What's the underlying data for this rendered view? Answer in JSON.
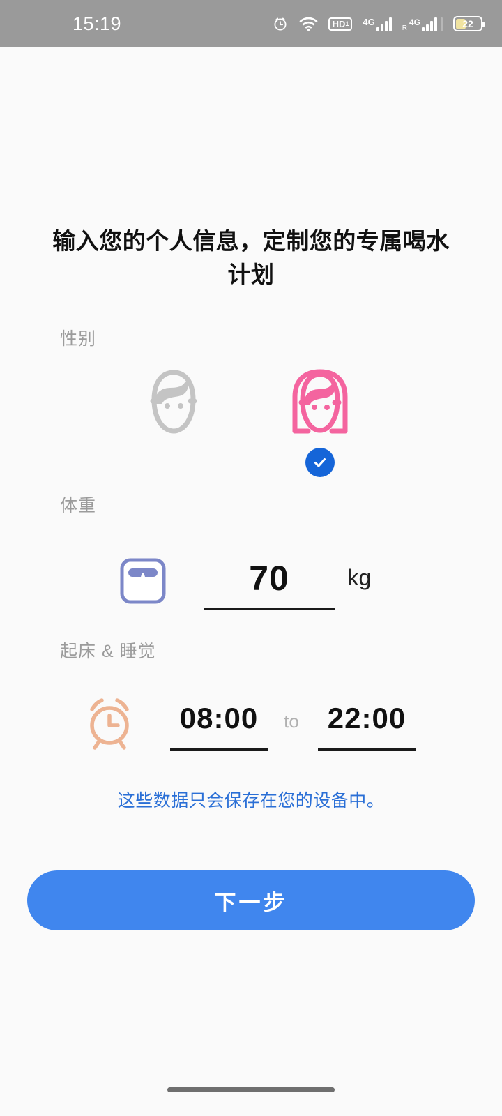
{
  "status_bar": {
    "time": "15:19",
    "battery_percent": "22",
    "icons": [
      {
        "name": "alarm-icon",
        "label": "alarm"
      },
      {
        "name": "wifi-icon",
        "label": "wifi"
      },
      {
        "name": "hd-voice-icon",
        "label": "HD"
      },
      {
        "name": "signal-4g-sim1-icon",
        "label": "4G"
      },
      {
        "name": "signal-4g-roaming-sim2-icon",
        "label": "4G"
      },
      {
        "name": "battery-icon",
        "label": "22"
      }
    ],
    "hd_label": "HD",
    "hd_sub": "1",
    "network_label_1": "4G",
    "network_label_2": "4G",
    "roaming_label": "R"
  },
  "page": {
    "title": "输入您的个人信息，定制您的专属喝水计划",
    "privacy_note": "这些数据只会保存在您的设备中。"
  },
  "gender": {
    "label": "性别",
    "options": [
      {
        "id": "male",
        "name": "gender-option-male",
        "selected": false,
        "color": "#c4c4c4"
      },
      {
        "id": "female",
        "name": "gender-option-female",
        "selected": true,
        "color": "#f4649f"
      }
    ],
    "selected": "female",
    "check_color": "#1565d8"
  },
  "weight": {
    "label": "体重",
    "value": "70",
    "unit": "kg",
    "icon_color": "#7c87c8"
  },
  "sleep": {
    "label": "起床 & 睡觉",
    "wake_time": "08:00",
    "separator": "to",
    "sleep_time": "22:00",
    "icon_color": "#edb392"
  },
  "actions": {
    "next_label": "下一步",
    "next_color": "#4086ee"
  },
  "colors": {
    "background": "#fafafa",
    "status_bar": "#9a9a9a",
    "accent_blue": "#4086ee",
    "link_blue": "#2a6fd6",
    "muted_text": "#9b9b9b"
  }
}
